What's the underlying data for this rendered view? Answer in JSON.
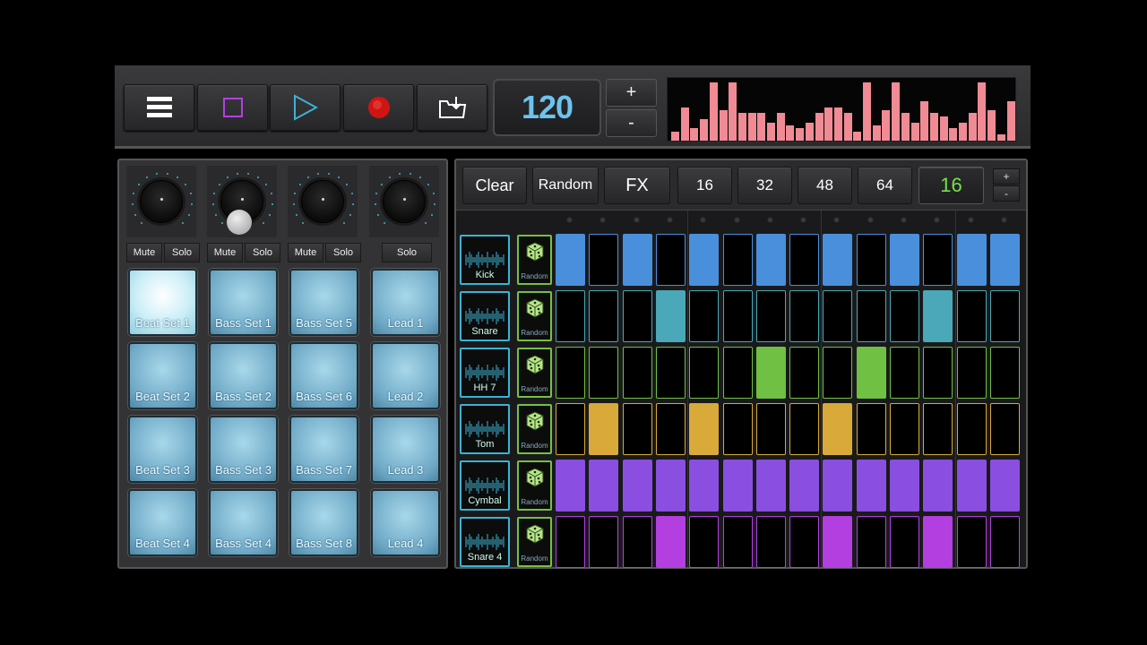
{
  "toolbar": {
    "buttons": [
      {
        "name": "menu-button",
        "icon": "menu-icon"
      },
      {
        "name": "stop-button",
        "icon": "stop-icon"
      },
      {
        "name": "play-button",
        "icon": "play-icon"
      },
      {
        "name": "record-button",
        "icon": "record-icon"
      },
      {
        "name": "open-folder-button",
        "icon": "folder-icon"
      }
    ],
    "tempo": "120",
    "tempo_plus": "+",
    "tempo_minus": "-"
  },
  "visualizer": {
    "color": "#f08a94",
    "levels": [
      0.15,
      0.55,
      0.2,
      0.35,
      0.95,
      0.5,
      0.95,
      0.45,
      0.45,
      0.45,
      0.3,
      0.45,
      0.25,
      0.2,
      0.3,
      0.45,
      0.55,
      0.55,
      0.45,
      0.15,
      0.95,
      0.25,
      0.5,
      0.95,
      0.45,
      0.3,
      0.65,
      0.45,
      0.4,
      0.2,
      0.3,
      0.45,
      0.95,
      0.5,
      0.1,
      0.65
    ]
  },
  "mixer": {
    "channels": [
      {
        "mute": "Mute",
        "solo": "Solo"
      },
      {
        "mute": "Mute",
        "solo": "Solo"
      },
      {
        "mute": "Mute",
        "solo": "Solo"
      },
      {
        "solo": "Solo"
      }
    ]
  },
  "pads": [
    [
      "Beat Set 1",
      "Bass Set 1",
      "Bass Set 5",
      "Lead 1"
    ],
    [
      "Beat Set 2",
      "Bass Set 2",
      "Bass Set 6",
      "Lead 2"
    ],
    [
      "Beat Set 3",
      "Bass Set 3",
      "Bass Set 7",
      "Lead 3"
    ],
    [
      "Beat Set 4",
      "Bass Set 4",
      "Bass Set 8",
      "Lead 4"
    ]
  ],
  "sequencer": {
    "controls": {
      "clear": "Clear",
      "random": "Random",
      "fx": "FX",
      "lengths": [
        "16",
        "32",
        "48",
        "64"
      ],
      "steps": "16",
      "steps_plus": "+",
      "steps_minus": "-"
    },
    "random_label": "Random",
    "tracks": [
      {
        "name": "Kick",
        "color": "#4a8fdb",
        "steps": [
          1,
          0,
          1,
          0,
          1,
          0,
          1,
          0,
          1,
          0,
          1,
          0,
          1,
          1
        ]
      },
      {
        "name": "Snare",
        "color": "#4aa8b8",
        "steps": [
          0,
          0,
          0,
          1,
          0,
          0,
          0,
          0,
          0,
          0,
          0,
          1,
          0,
          0
        ]
      },
      {
        "name": "HH 7",
        "color": "#6fc043",
        "steps": [
          0,
          0,
          0,
          0,
          0,
          0,
          1,
          0,
          0,
          1,
          0,
          0,
          0,
          0
        ]
      },
      {
        "name": "Tom",
        "color": "#d9a93a",
        "steps": [
          0,
          1,
          0,
          0,
          1,
          0,
          0,
          0,
          1,
          0,
          0,
          0,
          0,
          0
        ]
      },
      {
        "name": "Cymbal",
        "color": "#8a4fe0",
        "steps": [
          1,
          1,
          1,
          1,
          1,
          1,
          1,
          1,
          1,
          1,
          1,
          1,
          1,
          1
        ]
      },
      {
        "name": "Snare 4",
        "color": "#b43fe0",
        "steps": [
          0,
          0,
          0,
          1,
          0,
          0,
          0,
          0,
          1,
          0,
          0,
          1,
          0,
          0
        ]
      }
    ]
  }
}
